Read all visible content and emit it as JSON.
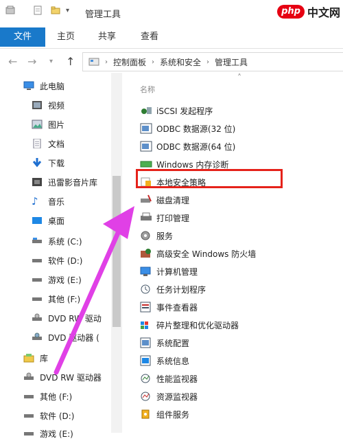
{
  "window": {
    "title": "管理工具"
  },
  "watermark": {
    "logo": "php",
    "text": "中文网"
  },
  "ribbon": {
    "tabs": [
      "文件",
      "主页",
      "共享",
      "查看"
    ]
  },
  "address": {
    "crumbs": [
      "控制面板",
      "系统和安全",
      "管理工具"
    ]
  },
  "nav": {
    "items": [
      {
        "label": "此电脑",
        "icon": "computer-icon"
      },
      {
        "label": "视频",
        "icon": "video-icon"
      },
      {
        "label": "图片",
        "icon": "picture-icon"
      },
      {
        "label": "文档",
        "icon": "document-icon"
      },
      {
        "label": "下载",
        "icon": "download-icon"
      },
      {
        "label": "迅雷影音片库",
        "icon": "media-library-icon"
      },
      {
        "label": "音乐",
        "icon": "music-icon"
      },
      {
        "label": "桌面",
        "icon": "desktop-icon"
      },
      {
        "label": "系统 (C:)",
        "icon": "drive-icon"
      },
      {
        "label": "软件 (D:)",
        "icon": "drive-icon"
      },
      {
        "label": "游戏 (E:)",
        "icon": "drive-icon"
      },
      {
        "label": "其他 (F:)",
        "icon": "drive-icon"
      },
      {
        "label": "DVD RW 驱动",
        "icon": "dvd-drive-icon"
      },
      {
        "label": "DVD 驱动器 (",
        "icon": "dvd-drive-icon"
      },
      {
        "label": "库",
        "icon": "library-icon"
      },
      {
        "label": "DVD RW 驱动器",
        "icon": "dvd-drive-icon"
      },
      {
        "label": "其他 (F:)",
        "icon": "drive-icon"
      },
      {
        "label": "软件 (D:)",
        "icon": "drive-icon"
      },
      {
        "label": "游戏 (E:)",
        "icon": "drive-icon"
      }
    ]
  },
  "content": {
    "column_header": "名称",
    "items": [
      {
        "label": "iSCSI 发起程序",
        "icon": "iscsi-icon"
      },
      {
        "label": "ODBC 数据源(32 位)",
        "icon": "odbc-icon"
      },
      {
        "label": "ODBC 数据源(64 位)",
        "icon": "odbc-icon"
      },
      {
        "label": "Windows 内存诊断",
        "icon": "memory-diagnostic-icon"
      },
      {
        "label": "本地安全策略",
        "icon": "security-policy-icon"
      },
      {
        "label": "磁盘清理",
        "icon": "disk-cleanup-icon"
      },
      {
        "label": "打印管理",
        "icon": "print-management-icon"
      },
      {
        "label": "服务",
        "icon": "services-icon"
      },
      {
        "label": "高级安全 Windows 防火墙",
        "icon": "firewall-icon"
      },
      {
        "label": "计算机管理",
        "icon": "computer-management-icon"
      },
      {
        "label": "任务计划程序",
        "icon": "task-scheduler-icon"
      },
      {
        "label": "事件查看器",
        "icon": "event-viewer-icon"
      },
      {
        "label": "碎片整理和优化驱动器",
        "icon": "defrag-icon"
      },
      {
        "label": "系统配置",
        "icon": "system-config-icon"
      },
      {
        "label": "系统信息",
        "icon": "system-info-icon"
      },
      {
        "label": "性能监视器",
        "icon": "performance-monitor-icon"
      },
      {
        "label": "资源监视器",
        "icon": "resource-monitor-icon"
      },
      {
        "label": "组件服务",
        "icon": "component-services-icon"
      }
    ]
  },
  "colors": {
    "file_tab": "#1979ca",
    "highlight_box": "#e5221a",
    "annotation_arrow": "#e040e6"
  }
}
